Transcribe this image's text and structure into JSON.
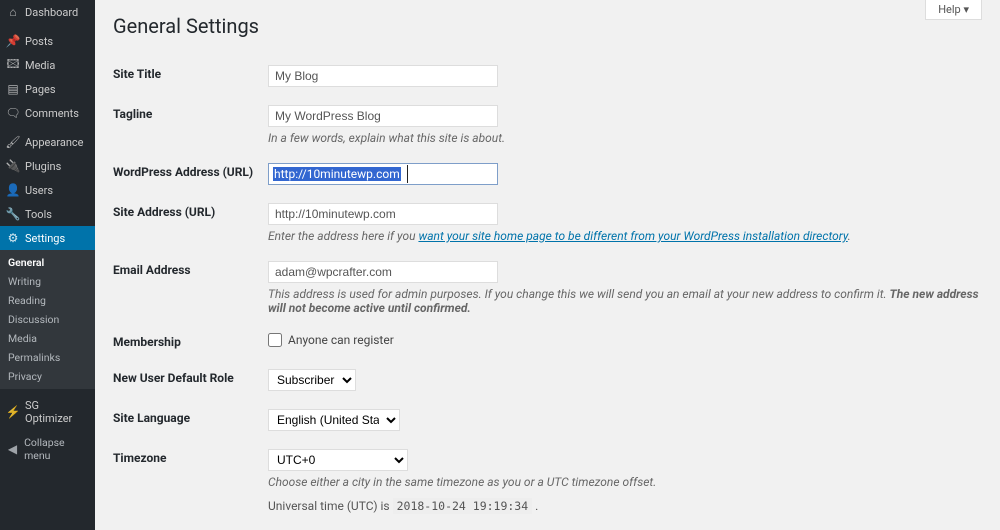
{
  "help_label": "Help",
  "page_title": "General Settings",
  "sidebar": {
    "items": [
      {
        "icon": "dashboard-icon",
        "glyph": "⌂",
        "label": "Dashboard"
      },
      {
        "icon": "posts-icon",
        "glyph": "📌",
        "label": "Posts"
      },
      {
        "icon": "media-icon",
        "glyph": "🖾",
        "label": "Media"
      },
      {
        "icon": "pages-icon",
        "glyph": "▤",
        "label": "Pages"
      },
      {
        "icon": "comments-icon",
        "glyph": "🗨",
        "label": "Comments"
      },
      {
        "icon": "appearance-icon",
        "glyph": "🖌",
        "label": "Appearance"
      },
      {
        "icon": "plugins-icon",
        "glyph": "🔌",
        "label": "Plugins"
      },
      {
        "icon": "users-icon",
        "glyph": "👤",
        "label": "Users"
      },
      {
        "icon": "tools-icon",
        "glyph": "🔧",
        "label": "Tools"
      },
      {
        "icon": "settings-icon",
        "glyph": "⚙",
        "label": "Settings"
      }
    ],
    "submenu": [
      "General",
      "Writing",
      "Reading",
      "Discussion",
      "Media",
      "Permalinks",
      "Privacy"
    ],
    "sg_label": "SG Optimizer",
    "collapse_label": "Collapse menu"
  },
  "form": {
    "site_title": {
      "label": "Site Title",
      "value": "My Blog"
    },
    "tagline": {
      "label": "Tagline",
      "value": "My WordPress Blog",
      "desc": "In a few words, explain what this site is about."
    },
    "wp_url": {
      "label": "WordPress Address (URL)",
      "value": "http://10minutewp.com"
    },
    "site_url": {
      "label": "Site Address (URL)",
      "value": "http://10minutewp.com",
      "desc_prefix": "Enter the address here if you ",
      "desc_link": "want your site home page to be different from your WordPress installation directory",
      "desc_suffix": "."
    },
    "email": {
      "label": "Email Address",
      "value": "adam@wpcrafter.com",
      "desc_plain": "This address is used for admin purposes. If you change this we will send you an email at your new address to confirm it. ",
      "desc_strong": "The new address will not become active until confirmed."
    },
    "membership": {
      "label": "Membership",
      "checkbox_label": "Anyone can register"
    },
    "default_role": {
      "label": "New User Default Role",
      "value": "Subscriber"
    },
    "language": {
      "label": "Site Language",
      "value": "English (United States)"
    },
    "timezone": {
      "label": "Timezone",
      "value": "UTC+0",
      "desc": "Choose either a city in the same timezone as you or a UTC timezone offset.",
      "utc_prefix": "Universal time (UTC) is ",
      "utc_value": "2018-10-24 19:19:34",
      "utc_suffix": " ."
    }
  }
}
